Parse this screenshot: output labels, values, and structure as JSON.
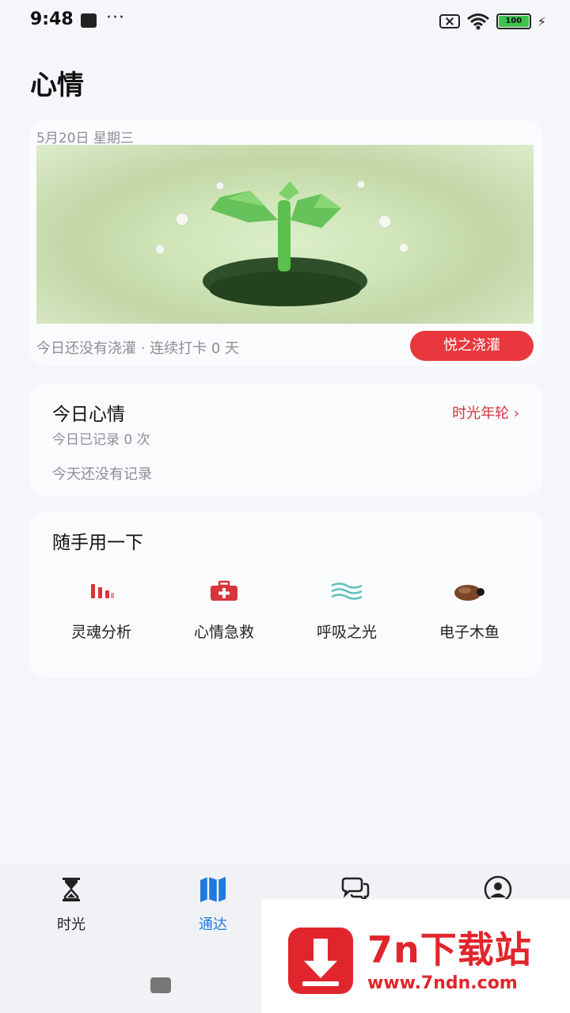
{
  "status_bar": {
    "time": "9:48",
    "dots": "···",
    "battery": "100"
  },
  "page": {
    "title": "心情"
  },
  "watering": {
    "date": "5月20日 星期三",
    "status": "今日还没有浇灌 · 连续打卡 0 天",
    "button_label": "悦之浇灌"
  },
  "mood": {
    "title": "今日心情",
    "link_label": "时光年轮 ›",
    "count_text": "今日已记录 0 次",
    "empty_text": "今天还没有记录"
  },
  "tools": {
    "title": "随手用一下",
    "items": [
      {
        "label": "灵魂分析",
        "icon": "bar-chart-icon",
        "color": "#d8343a"
      },
      {
        "label": "心情急救",
        "icon": "first-aid-kit-icon",
        "color": "#d8343a"
      },
      {
        "label": "呼吸之光",
        "icon": "waves-icon",
        "color": "#5fc1bf"
      },
      {
        "label": "电子木鱼",
        "icon": "wooden-fish-icon",
        "color": "#5a3220"
      }
    ]
  },
  "nav": {
    "items": [
      {
        "label": "时光",
        "icon": "hourglass-icon",
        "active": false
      },
      {
        "label": "通达",
        "icon": "map-icon",
        "active": true
      },
      {
        "label": "",
        "icon": "chat-icon",
        "active": false
      },
      {
        "label": "",
        "icon": "profile-icon",
        "active": false
      }
    ],
    "active_color": "#1f7ae0"
  },
  "watermark": {
    "title": "7n下载站",
    "url": "www.7ndn.com"
  },
  "colors": {
    "accent": "#e8383d",
    "background": "#f4f6fa"
  }
}
